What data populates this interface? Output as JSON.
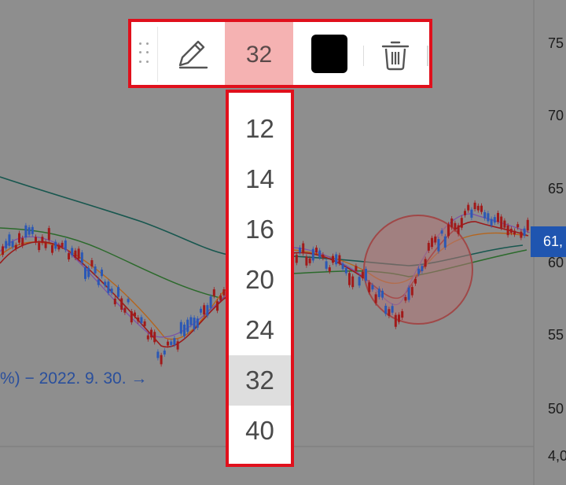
{
  "axis_labels": [
    "75",
    "70",
    "65",
    "60",
    "55",
    "50",
    "4,0"
  ],
  "price_tag": "61,",
  "annotation": "%) − 2022. 9. 30. →",
  "toolbar": {
    "size_value": "32",
    "selected_color": "#000000",
    "icons": [
      "grip-icon",
      "pencil-icon",
      "trash-icon"
    ]
  },
  "size_dropdown": {
    "options": [
      "12",
      "14",
      "16",
      "20",
      "24",
      "32",
      "40"
    ],
    "selected": "32"
  },
  "colors": {
    "background": "#8e8e8e",
    "highlight_border": "#e0101c",
    "size_button_bg": "#f5b2b2",
    "price_tag_bg": "#1f55b0",
    "candle_up": "#2b58b5",
    "candle_down": "#a11a1a"
  }
}
